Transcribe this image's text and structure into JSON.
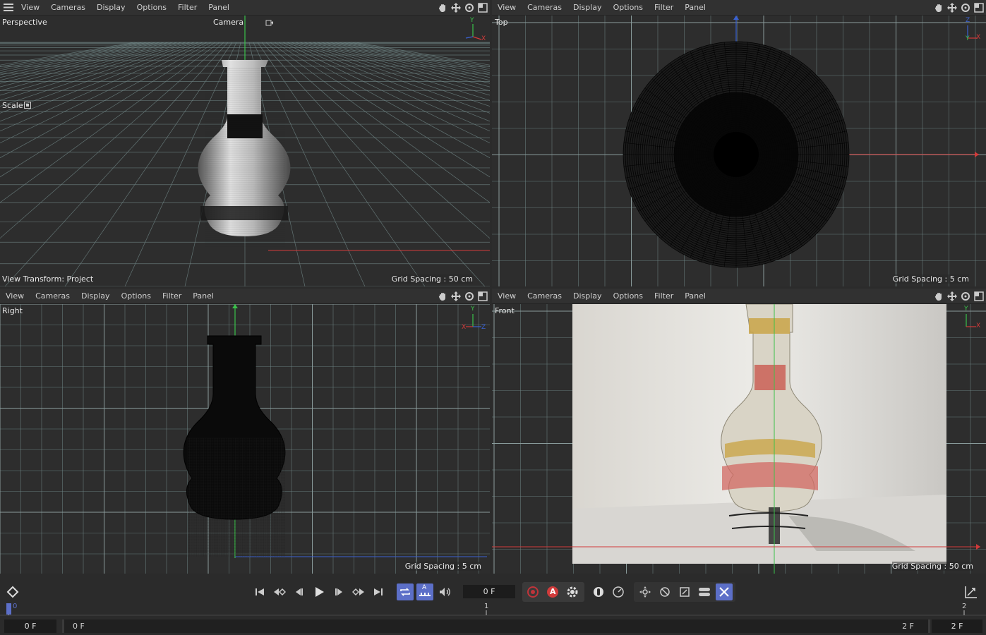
{
  "menus": [
    "View",
    "Cameras",
    "Display",
    "Options",
    "Filter",
    "Panel"
  ],
  "viewports": {
    "perspective": {
      "name": "Perspective",
      "camera": "Camera",
      "scale_label": "Scale",
      "view_transform": "View Transform: Project",
      "grid_spacing": "Grid Spacing : 50 cm"
    },
    "top": {
      "name": "Top",
      "grid_spacing": "Grid Spacing : 5 cm"
    },
    "right": {
      "name": "Right",
      "grid_spacing": "Grid Spacing : 5 cm"
    },
    "front": {
      "name": "Front",
      "grid_spacing": "Grid Spacing : 50 cm"
    }
  },
  "axes": {
    "x": "X",
    "y": "Y",
    "z": "Z"
  },
  "timeline": {
    "current_frame": "0 F",
    "ruler_marks": [
      "0",
      "1",
      "2"
    ],
    "start_frame": "0 F",
    "range_start": "0 F",
    "range_end": "2 F",
    "end_frame": "2 F",
    "record_label": "A",
    "anim_label": "A"
  },
  "colors": {
    "x_axis": "#d23a3a",
    "y_axis": "#3ac24a",
    "z_axis": "#3a62d2",
    "grid": "#6f8585",
    "active_button": "#5c6fc8"
  }
}
